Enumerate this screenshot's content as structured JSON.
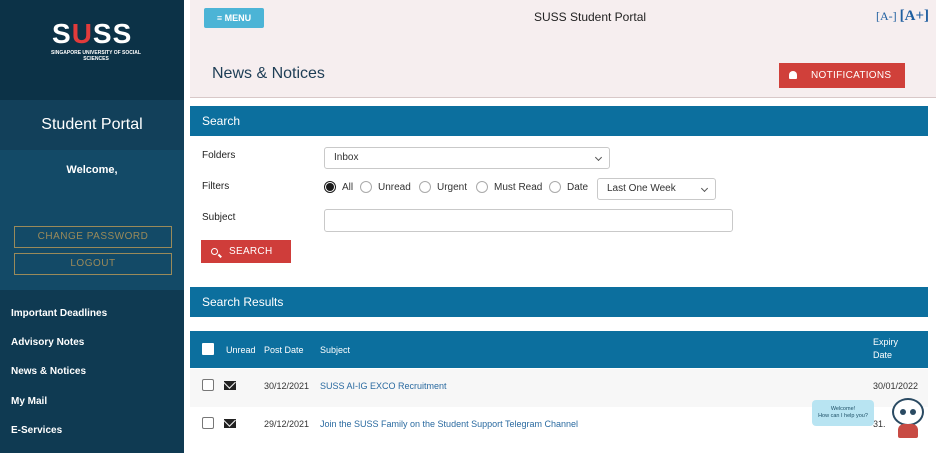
{
  "sidebar": {
    "logo_text": "SUSS",
    "logo_subtitle": "SINGAPORE UNIVERSITY OF SOCIAL SCIENCES",
    "portal_title": "Student Portal",
    "welcome": "Welcome,",
    "change_password": "CHANGE PASSWORD",
    "logout": "LOGOUT",
    "nav": [
      {
        "label": "Important Deadlines"
      },
      {
        "label": "Advisory Notes"
      },
      {
        "label": "News & Notices"
      },
      {
        "label": "My Mail"
      },
      {
        "label": "E-Services"
      }
    ]
  },
  "header": {
    "menu_label": "MENU",
    "app_title": "SUSS Student Portal",
    "font_decrease": "[A-]",
    "font_increase": "[A+]",
    "page_title": "News & Notices",
    "notifications_label": "NOTIFICATIONS"
  },
  "search": {
    "title": "Search",
    "folders_label": "Folders",
    "folder_value": "Inbox",
    "filters_label": "Filters",
    "filters": [
      {
        "label": "All",
        "checked": true
      },
      {
        "label": "Unread",
        "checked": false
      },
      {
        "label": "Urgent",
        "checked": false
      },
      {
        "label": "Must Read",
        "checked": false
      },
      {
        "label": "Date",
        "checked": false
      }
    ],
    "date_range_value": "Last One Week",
    "subject_label": "Subject",
    "subject_value": "",
    "search_button": "SEARCH"
  },
  "results": {
    "title": "Search Results",
    "columns": {
      "unread": "Unread",
      "post_date": "Post Date",
      "subject": "Subject",
      "expiry_date_line1": "Expiry",
      "expiry_date_line2": "Date"
    },
    "rows": [
      {
        "post_date": "30/12/2021",
        "subject": "SUSS AI-IG EXCO Recruitment",
        "expiry": "30/01/2022",
        "unread": true
      },
      {
        "post_date": "29/12/2021",
        "subject": "Join the SUSS Family on the Student Support Telegram Channel",
        "expiry": "31.",
        "unread": true
      }
    ]
  },
  "chatbot": {
    "line1": "Welcome!",
    "line2": "How can I help you?"
  },
  "colors": {
    "sidebar": "#0f3a52",
    "accent_blue": "#0c6f9e",
    "danger_red": "#cf3d3a",
    "menu_blue": "#4cb4d6"
  }
}
